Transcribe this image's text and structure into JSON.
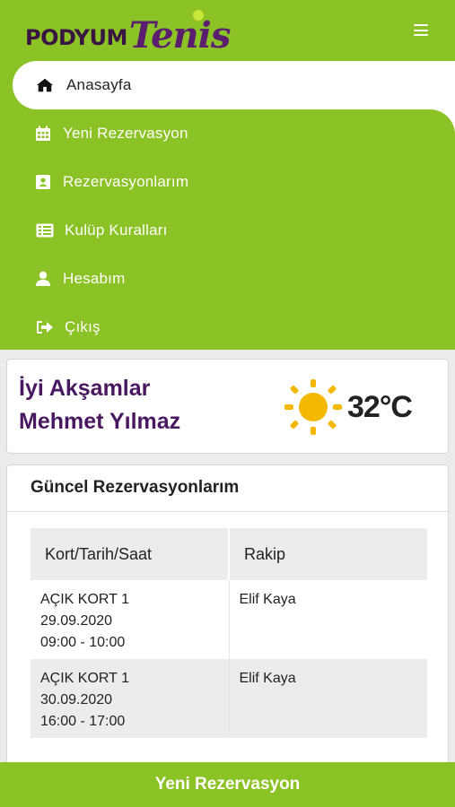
{
  "header": {
    "logo": {
      "part1": "PODYUM",
      "part2": "Tenis"
    }
  },
  "nav": {
    "items": [
      {
        "label": "Anasayfa",
        "icon": "home-icon",
        "active": true
      },
      {
        "label": "Yeni Rezervasyon",
        "icon": "calendar-icon",
        "active": false
      },
      {
        "label": "Rezervasyonlarım",
        "icon": "contact-card-icon",
        "active": false
      },
      {
        "label": "Kulüp Kuralları",
        "icon": "list-icon",
        "active": false
      },
      {
        "label": "Hesabım",
        "icon": "user-icon",
        "active": false
      },
      {
        "label": "Çıkış",
        "icon": "sign-out-icon",
        "active": false
      }
    ]
  },
  "greeting": {
    "line1": "İyi Akşamlar",
    "line2": "Mehmet Yılmaz",
    "weather_icon": "sun-icon",
    "temperature": "32°C"
  },
  "reservations": {
    "title": "Güncel Rezervasyonlarım",
    "columns": [
      "Kort/Tarih/Saat",
      "Rakip"
    ],
    "rows": [
      {
        "court": "AÇIK KORT 1",
        "date": "29.09.2020",
        "time": "09:00 - 10:00",
        "opponent": "Elif Kaya"
      },
      {
        "court": "AÇIK KORT 1",
        "date": "30.09.2020",
        "time": "16:00 - 17:00",
        "opponent": "Elif Kaya"
      }
    ]
  },
  "bottom_button": {
    "label": "Yeni Rezervasyon"
  },
  "colors": {
    "brand_green": "#8bc225",
    "brand_purple": "#4a1860",
    "sun_yellow": "#f5b800"
  }
}
